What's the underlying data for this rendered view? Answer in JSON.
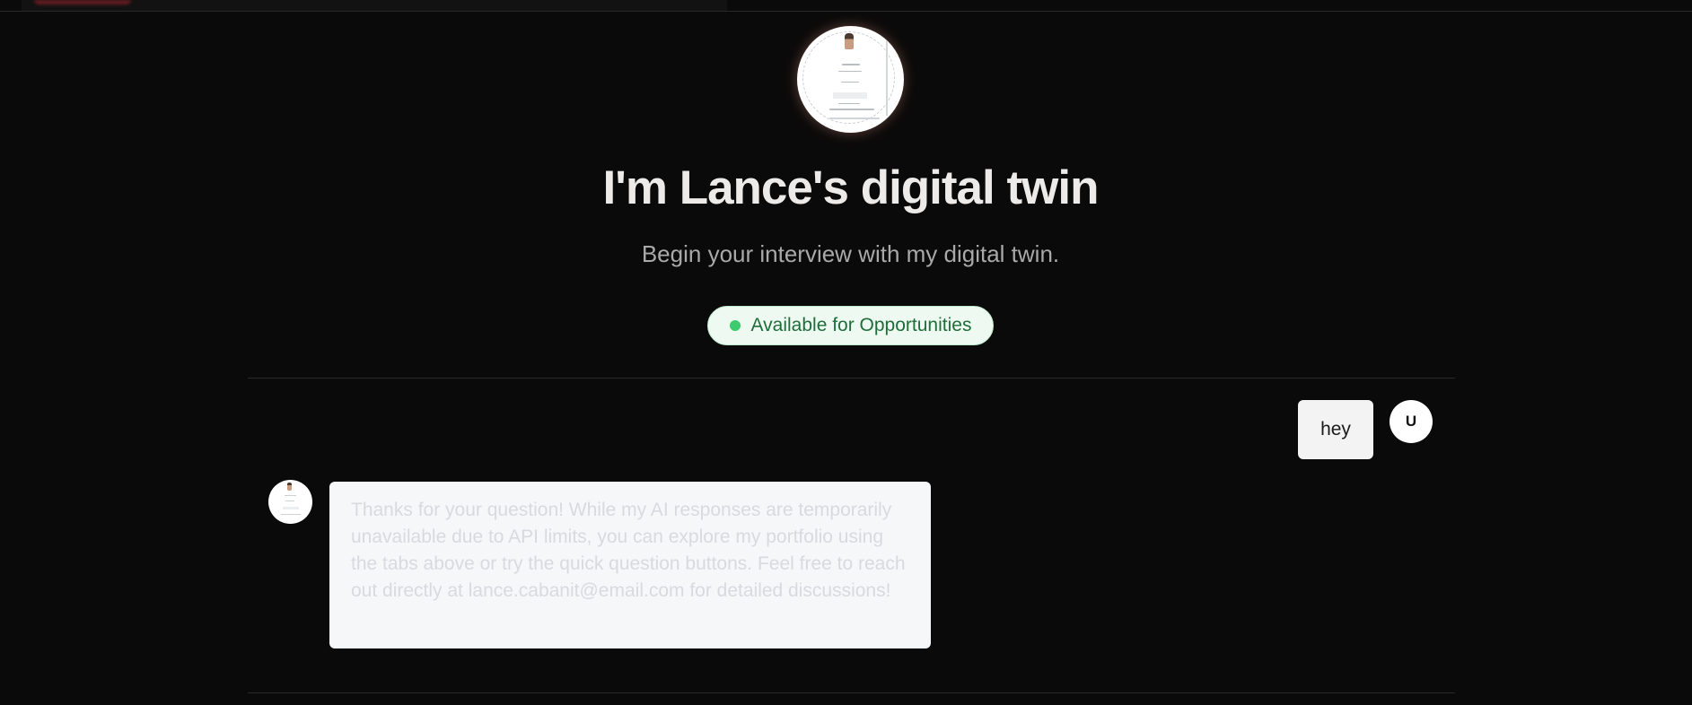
{
  "hero": {
    "title": "I'm Lance's digital twin",
    "subtitle": "Begin your interview with my digital twin.",
    "status_badge": "Available for Opportunities"
  },
  "colors": {
    "background": "#0b0a0a",
    "status_green": "#3ecb6d",
    "status_text": "#1f6e3a",
    "title_text": "#ecebea"
  },
  "chat": {
    "messages": [
      {
        "role": "user",
        "avatar_initial": "U",
        "text": "hey"
      },
      {
        "role": "assistant",
        "text": "Thanks for your question! While my AI responses are temporarily unavailable due to API limits, you can explore my portfolio using the tabs above or try the quick question buttons. Feel free to reach out directly at lance.cabanit@email.com for detailed discussions!"
      }
    ]
  }
}
